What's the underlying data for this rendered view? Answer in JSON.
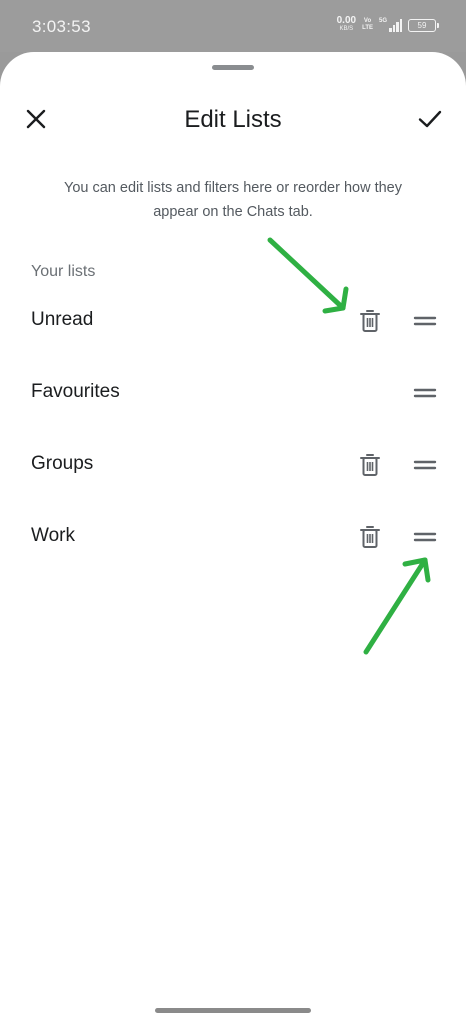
{
  "status_bar": {
    "time": "3:03:53",
    "net_speed_value": "0.00",
    "net_speed_unit": "KB/S",
    "volte_top": "Vo",
    "volte_bottom": "LTE",
    "network_type": "5G",
    "battery_level": "59"
  },
  "header": {
    "title": "Edit Lists",
    "close_icon": "close-icon",
    "confirm_icon": "check-icon"
  },
  "description": "You can edit lists and filters here or reorder how they appear on the Chats tab.",
  "section_label": "Your lists",
  "lists": [
    {
      "label": "Unread",
      "deletable": true
    },
    {
      "label": "Favourites",
      "deletable": false
    },
    {
      "label": "Groups",
      "deletable": true
    },
    {
      "label": "Work",
      "deletable": true
    }
  ],
  "colors": {
    "annotation_arrow": "#2fb043",
    "icon": "#5f6368",
    "text_primary": "#1b1d1f",
    "text_secondary": "#545a60"
  }
}
